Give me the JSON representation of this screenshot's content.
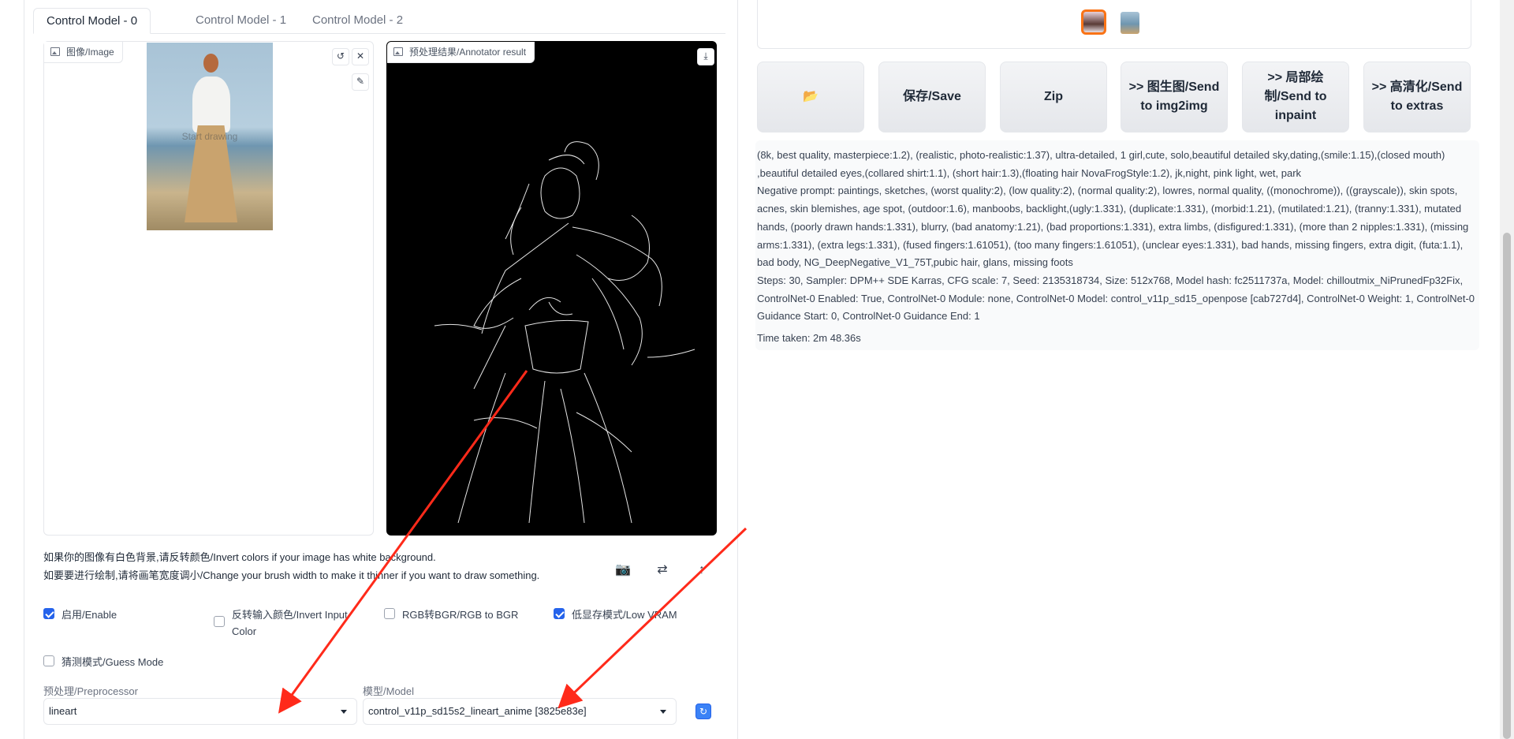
{
  "tabs": [
    {
      "label": "Control Model - 0",
      "active": true
    },
    {
      "label": "Control Model - 1",
      "active": false
    },
    {
      "label": "Control Model - 2",
      "active": false
    }
  ],
  "image_panel": {
    "label": "图像/Image",
    "overlay_text": "Start drawing"
  },
  "result_panel": {
    "label": "预处理结果/Annotator result"
  },
  "hints": {
    "line1": "如果你的图像有白色背景,请反转颜色/Invert colors if your image has white background.",
    "line2": "如要要进行绘制,请将画笔宽度调小/Change your brush width to make it thinner if you want to draw something."
  },
  "options": {
    "enable": {
      "label": "启用/Enable",
      "checked": true
    },
    "invert": {
      "label": "反转输入颜色/Invert Input Color",
      "checked": false
    },
    "rgb2bgr": {
      "label": "RGB转BGR/RGB to BGR",
      "checked": false
    },
    "lowvram": {
      "label": "低显存模式/Low VRAM",
      "checked": true
    },
    "guess": {
      "label": "猜测模式/Guess Mode",
      "checked": false
    }
  },
  "preprocessor": {
    "label": "预处理/Preprocessor",
    "value": "lineart"
  },
  "model": {
    "label": "模型/Model",
    "value": "control_v11p_sd15s2_lineart_anime [3825e83e]"
  },
  "right_buttons": [
    {
      "label": "📂"
    },
    {
      "label": "保存/Save"
    },
    {
      "label": "Zip"
    },
    {
      "label": ">> 图生图/Send to img2img"
    },
    {
      "label": ">> 局部绘制/Send to inpaint"
    },
    {
      "label": ">> 高清化/Send to extras"
    }
  ],
  "generation_info": {
    "prompt": "(8k, best quality, masterpiece:1.2), (realistic, photo-realistic:1.37), ultra-detailed, 1 girl,cute, solo,beautiful detailed sky,dating,(smile:1.15),(closed mouth) ,beautiful detailed eyes,(collared shirt:1.1), (short hair:1.3),(floating hair NovaFrogStyle:1.2), jk,night, pink light, wet, park",
    "negative": "Negative prompt: paintings, sketches, (worst quality:2), (low quality:2), (normal quality:2), lowres, normal quality, ((monochrome)), ((grayscale)), skin spots, acnes, skin blemishes, age spot, (outdoor:1.6), manboobs, backlight,(ugly:1.331), (duplicate:1.331), (morbid:1.21), (mutilated:1.21), (tranny:1.331), mutated hands, (poorly drawn hands:1.331), blurry, (bad anatomy:1.21), (bad proportions:1.331), extra limbs, (disfigured:1.331), (more than 2 nipples:1.331), (missing arms:1.331), (extra legs:1.331), (fused fingers:1.61051), (too many fingers:1.61051), (unclear eyes:1.331), bad hands, missing fingers, extra digit, (futa:1.1), bad body, NG_DeepNegative_V1_75T,pubic hair, glans, missing foots",
    "params": "Steps: 30, Sampler: DPM++ SDE Karras, CFG scale: 7, Seed: 2135318734, Size: 512x768, Model hash: fc2511737a, Model: chilloutmix_NiPrunedFp32Fix, ControlNet-0 Enabled: True, ControlNet-0 Module: none, ControlNet-0 Model: control_v11p_sd15_openpose [cab727d4], ControlNet-0 Weight: 1, ControlNet-0 Guidance Start: 0, ControlNet-0 Guidance End: 1",
    "time_taken": "Time taken: 2m 48.36s"
  },
  "colors": {
    "accent": "#2563eb",
    "selected_thumb": "#f97316",
    "annotation_arrow": "#ff2a1a"
  }
}
